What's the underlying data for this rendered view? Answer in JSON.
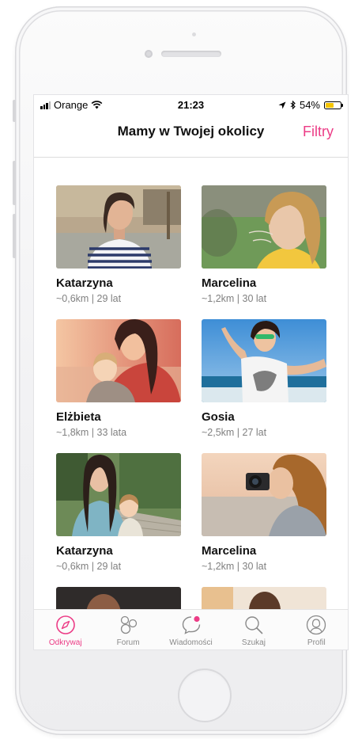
{
  "status_bar": {
    "carrier": "Orange",
    "time": "21:23",
    "battery": "54%",
    "battery_level": 0.54
  },
  "header": {
    "title": "Mamy w Twojej okolicy",
    "filter_label": "Filtry"
  },
  "profiles": [
    {
      "name": "Katarzyna",
      "meta": "~0,6km | 29 lat"
    },
    {
      "name": "Marcelina",
      "meta": "~1,2km | 30 lat"
    },
    {
      "name": "Elżbieta",
      "meta": "~1,8km | 33 lata"
    },
    {
      "name": "Gosia",
      "meta": "~2,5km | 27 lat"
    },
    {
      "name": "Katarzyna",
      "meta": "~0,6km | 29 lat"
    },
    {
      "name": "Marcelina",
      "meta": "~1,2km | 30 lat"
    }
  ],
  "tabs": [
    {
      "label": "Odkrywaj",
      "icon": "compass-icon",
      "active": true
    },
    {
      "label": "Forum",
      "icon": "forum-bubbles-icon",
      "active": false
    },
    {
      "label": "Wiadomości",
      "icon": "message-bubble-icon",
      "active": false,
      "badge": true
    },
    {
      "label": "Szukaj",
      "icon": "search-icon",
      "active": false
    },
    {
      "label": "Profil",
      "icon": "profile-icon",
      "active": false
    }
  ],
  "colors": {
    "accent": "#ec3c86",
    "battery": "#f5c400"
  }
}
